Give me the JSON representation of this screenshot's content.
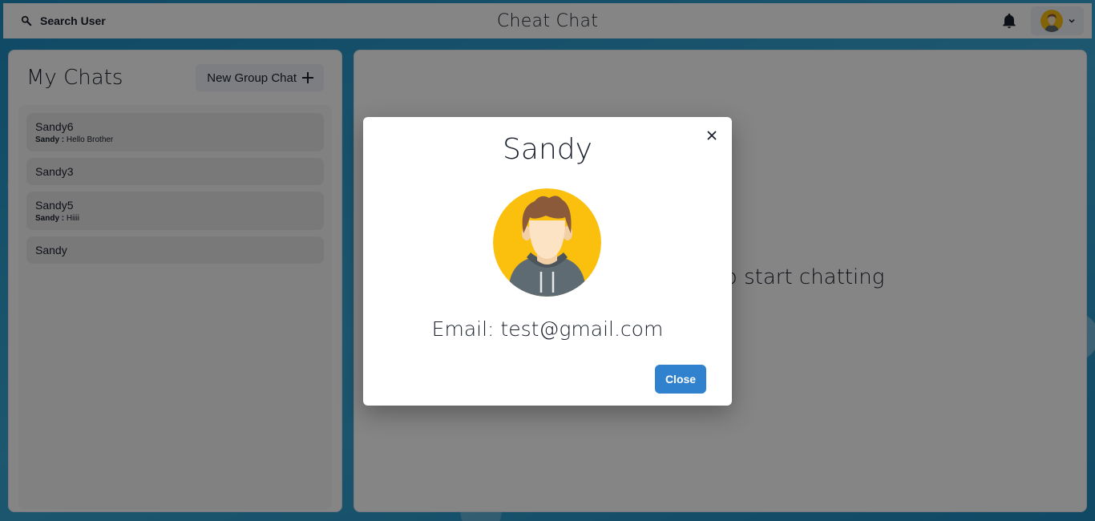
{
  "header": {
    "search_label": "Search User",
    "app_title": "Cheat Chat"
  },
  "my_chats": {
    "title": "My Chats",
    "new_group_label": "New Group Chat",
    "chats": [
      {
        "name": "Sandy6",
        "sender": "Sandy :",
        "message": "Hello Brother"
      },
      {
        "name": "Sandy3"
      },
      {
        "name": "Sandy5",
        "sender": "Sandy :",
        "message": "Hiiii"
      },
      {
        "name": "Sandy"
      }
    ]
  },
  "chatbox": {
    "hint": "Click on a user to start chatting"
  },
  "profile_modal": {
    "name": "Sandy",
    "email": "Email: test@gmail.com",
    "close_label": "Close"
  },
  "colors": {
    "accent": "#3182ce",
    "avatar_bg": "#fbbf0e",
    "page_bg": "#2a97c9"
  }
}
